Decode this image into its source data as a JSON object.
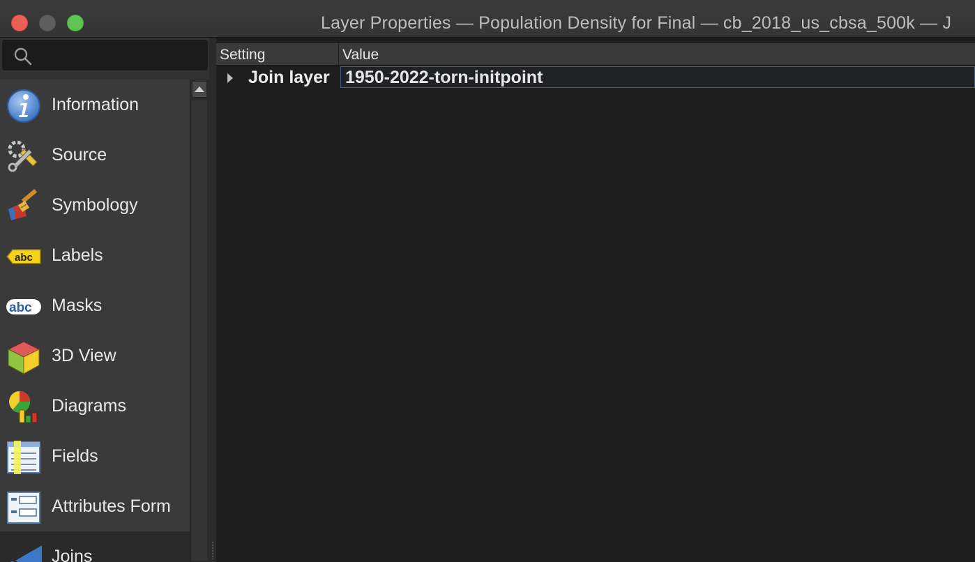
{
  "window": {
    "title": "Layer Properties — Population Density for Final — cb_2018_us_cbsa_500k — J"
  },
  "search": {
    "placeholder": "",
    "value": ""
  },
  "sidebar": {
    "items": [
      {
        "label": "Information",
        "icon": "information-icon"
      },
      {
        "label": "Source",
        "icon": "source-wrench-icon"
      },
      {
        "label": "Symbology",
        "icon": "symbology-brush-icon"
      },
      {
        "label": "Labels",
        "icon": "labels-abc-tag-icon"
      },
      {
        "label": "Masks",
        "icon": "masks-abc-icon"
      },
      {
        "label": "3D View",
        "icon": "3d-cube-icon"
      },
      {
        "label": "Diagrams",
        "icon": "diagrams-icon"
      },
      {
        "label": "Fields",
        "icon": "fields-icon"
      },
      {
        "label": "Attributes Form",
        "icon": "attributes-form-icon"
      },
      {
        "label": "Joins",
        "icon": "joins-icon"
      }
    ],
    "selected": "Joins"
  },
  "tree": {
    "columns": [
      "Setting",
      "Value"
    ],
    "rows": [
      {
        "setting": "Join layer",
        "value": "1950-2022-torn-initpoint"
      }
    ]
  },
  "colors": {
    "close": "#ec5f57",
    "minimize": "#5e5e5e",
    "zoom": "#5fc453",
    "selection_border": "#3e5f8a"
  }
}
